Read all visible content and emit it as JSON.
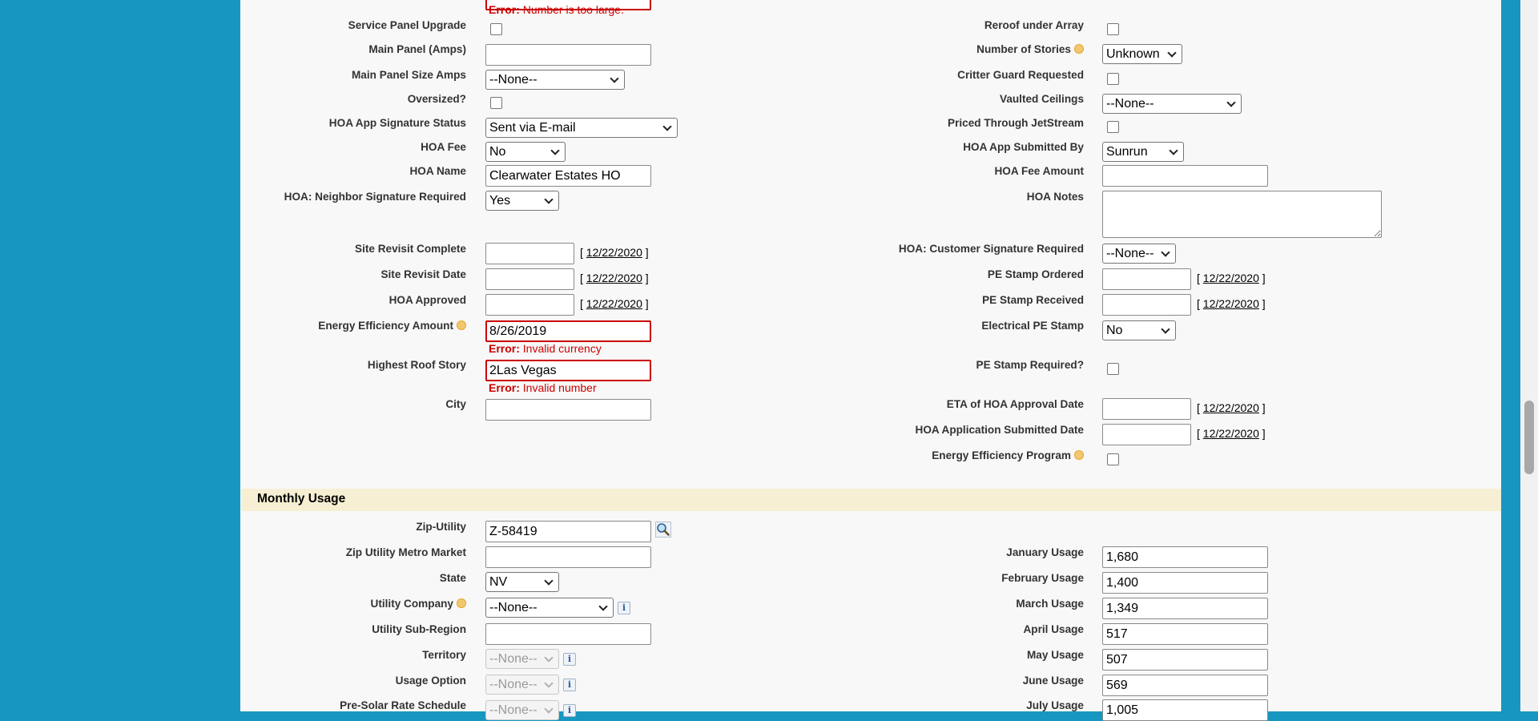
{
  "top_error": "Number is too large.",
  "error_prefix": "Error:",
  "labels": {
    "service_panel_upgrade": "Service Panel Upgrade",
    "main_panel_amps": "Main Panel (Amps)",
    "main_panel_size_amps": "Main Panel Size Amps",
    "oversized": "Oversized?",
    "hoa_app_signature_status": "HOA App Signature Status",
    "hoa_fee": "HOA Fee",
    "hoa_name": "HOA Name",
    "hoa_neighbor_signature_required": "HOA: Neighbor Signature Required",
    "site_revisit_complete": "Site Revisit Complete",
    "site_revisit_date": "Site Revisit Date",
    "hoa_approved": "HOA Approved",
    "energy_efficiency_amount": "Energy Efficiency Amount",
    "highest_roof_story": "Highest Roof Story",
    "city": "City",
    "reroof_under_array": "Reroof under Array",
    "number_of_stories": "Number of Stories",
    "critter_guard_requested": "Critter Guard Requested",
    "vaulted_ceilings": "Vaulted Ceilings",
    "priced_through_jetstream": "Priced Through JetStream",
    "hoa_app_submitted_by": "HOA App Submitted By",
    "hoa_fee_amount": "HOA Fee Amount",
    "hoa_notes": "HOA Notes",
    "hoa_customer_signature_required": "HOA: Customer Signature Required",
    "pe_stamp_ordered": "PE Stamp Ordered",
    "pe_stamp_received": "PE Stamp Received",
    "electrical_pe_stamp": "Electrical PE Stamp",
    "pe_stamp_required": "PE Stamp Required?",
    "eta_of_hoa_approval_date": "ETA of HOA Approval Date",
    "hoa_application_submitted_date": "HOA Application Submitted Date",
    "energy_efficiency_program": "Energy Efficiency Program",
    "zip_utility": "Zip-Utility",
    "zip_utility_metro_market": "Zip Utility Metro Market",
    "state": "State",
    "utility_company": "Utility Company",
    "utility_sub_region": "Utility Sub-Region",
    "territory": "Territory",
    "usage_option": "Usage Option",
    "pre_solar_rate_schedule": "Pre-Solar Rate Schedule",
    "january_usage": "January Usage",
    "february_usage": "February Usage",
    "march_usage": "March Usage",
    "april_usage": "April Usage",
    "may_usage": "May Usage",
    "june_usage": "June Usage",
    "july_usage": "July Usage"
  },
  "values": {
    "main_panel_amps": "",
    "main_panel_size_amps": "--None--",
    "hoa_app_signature_status": "Sent via E-mail",
    "hoa_fee": "No",
    "hoa_name": "Clearwater Estates HO",
    "hoa_neighbor_signature_required": "Yes",
    "energy_efficiency_amount": "8/26/2019",
    "energy_efficiency_amount_error": "Invalid currency",
    "highest_roof_story": "2Las Vegas",
    "highest_roof_story_error": "Invalid number",
    "city": "",
    "number_of_stories": "Unknown",
    "vaulted_ceilings": "--None--",
    "hoa_app_submitted_by": "Sunrun",
    "hoa_fee_amount": "",
    "hoa_notes": "",
    "hoa_customer_signature_required": "--None--",
    "electrical_pe_stamp": "No",
    "zip_utility": "Z-58419",
    "zip_utility_metro_market": "",
    "state": "NV",
    "utility_company": "--None--",
    "utility_sub_region": "",
    "territory": "--None--",
    "usage_option": "--None--",
    "pre_solar_rate_schedule": "--None--",
    "january_usage": "1,680",
    "february_usage": "1,400",
    "march_usage": "1,349",
    "april_usage": "517",
    "may_usage": "507",
    "june_usage": "569",
    "july_usage": "1,005"
  },
  "date_link": "12/22/2020",
  "date_open": "[",
  "date_close": "]",
  "section_title": "Monthly Usage",
  "icons": {
    "help": "help-bubble-icon",
    "info": "info-icon",
    "lookup": "lookup-magnifier-icon"
  },
  "colors": {
    "outer_background": "#1797c0",
    "page_background": "#f8f8f8",
    "error": "#cc0000",
    "section_header": "#f6efd3",
    "help_icon": "#f3c76d"
  }
}
